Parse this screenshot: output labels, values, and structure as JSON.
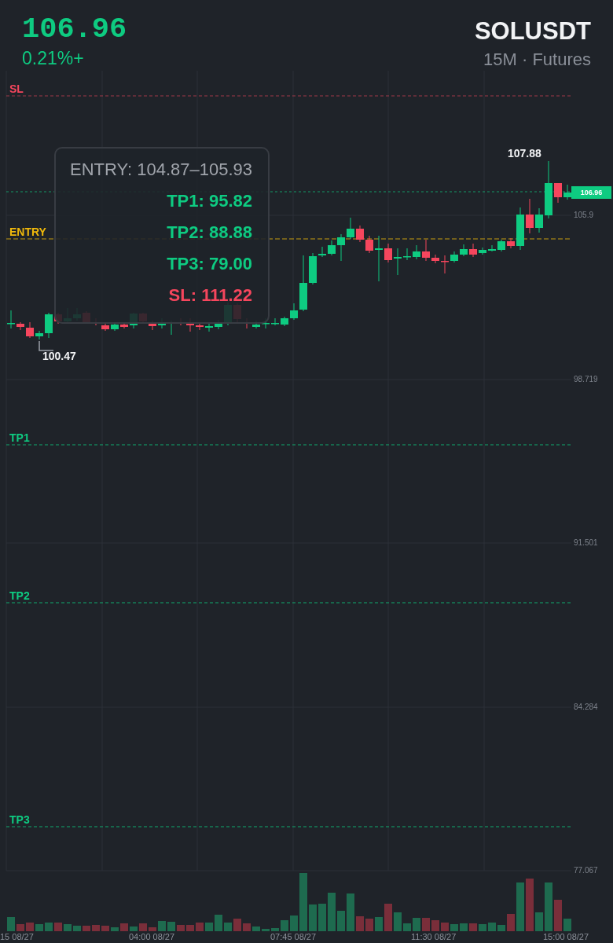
{
  "header": {
    "price": "106.96",
    "change": "0.21%+",
    "symbol": "SOLUSDT",
    "subtitle": "15M · Futures"
  },
  "levels": [
    {
      "label": "SL",
      "kind": "sl",
      "color": "#f6465d"
    },
    {
      "label": "ENTRY",
      "kind": "entry",
      "color": "#f0b90b"
    },
    {
      "label": "TP1",
      "kind": "tp",
      "color": "#0ecb81"
    },
    {
      "label": "TP2",
      "kind": "tp",
      "color": "#0ecb81"
    },
    {
      "label": "TP3",
      "kind": "tp",
      "color": "#0ecb81"
    }
  ],
  "info_box": [
    {
      "text": "ENTRY: 104.87–105.93",
      "kind": "entry"
    },
    {
      "text": "TP1: 95.82",
      "kind": "tp"
    },
    {
      "text": "TP2: 88.88",
      "kind": "tp"
    },
    {
      "text": "TP3: 79.00",
      "kind": "tp"
    },
    {
      "text": "SL: 111.22",
      "kind": "sl"
    }
  ],
  "price_axis": [
    "105.9",
    "98.719",
    "91.501",
    "84.284",
    "77.067"
  ],
  "current_price_tag": "106.96",
  "high_label": "107.88",
  "low_label": "100.47",
  "time_axis": [
    "15 08/27",
    "04:00 08/27",
    "07:45 08/27",
    "11:30 08/27",
    "15:00 08/27"
  ]
}
